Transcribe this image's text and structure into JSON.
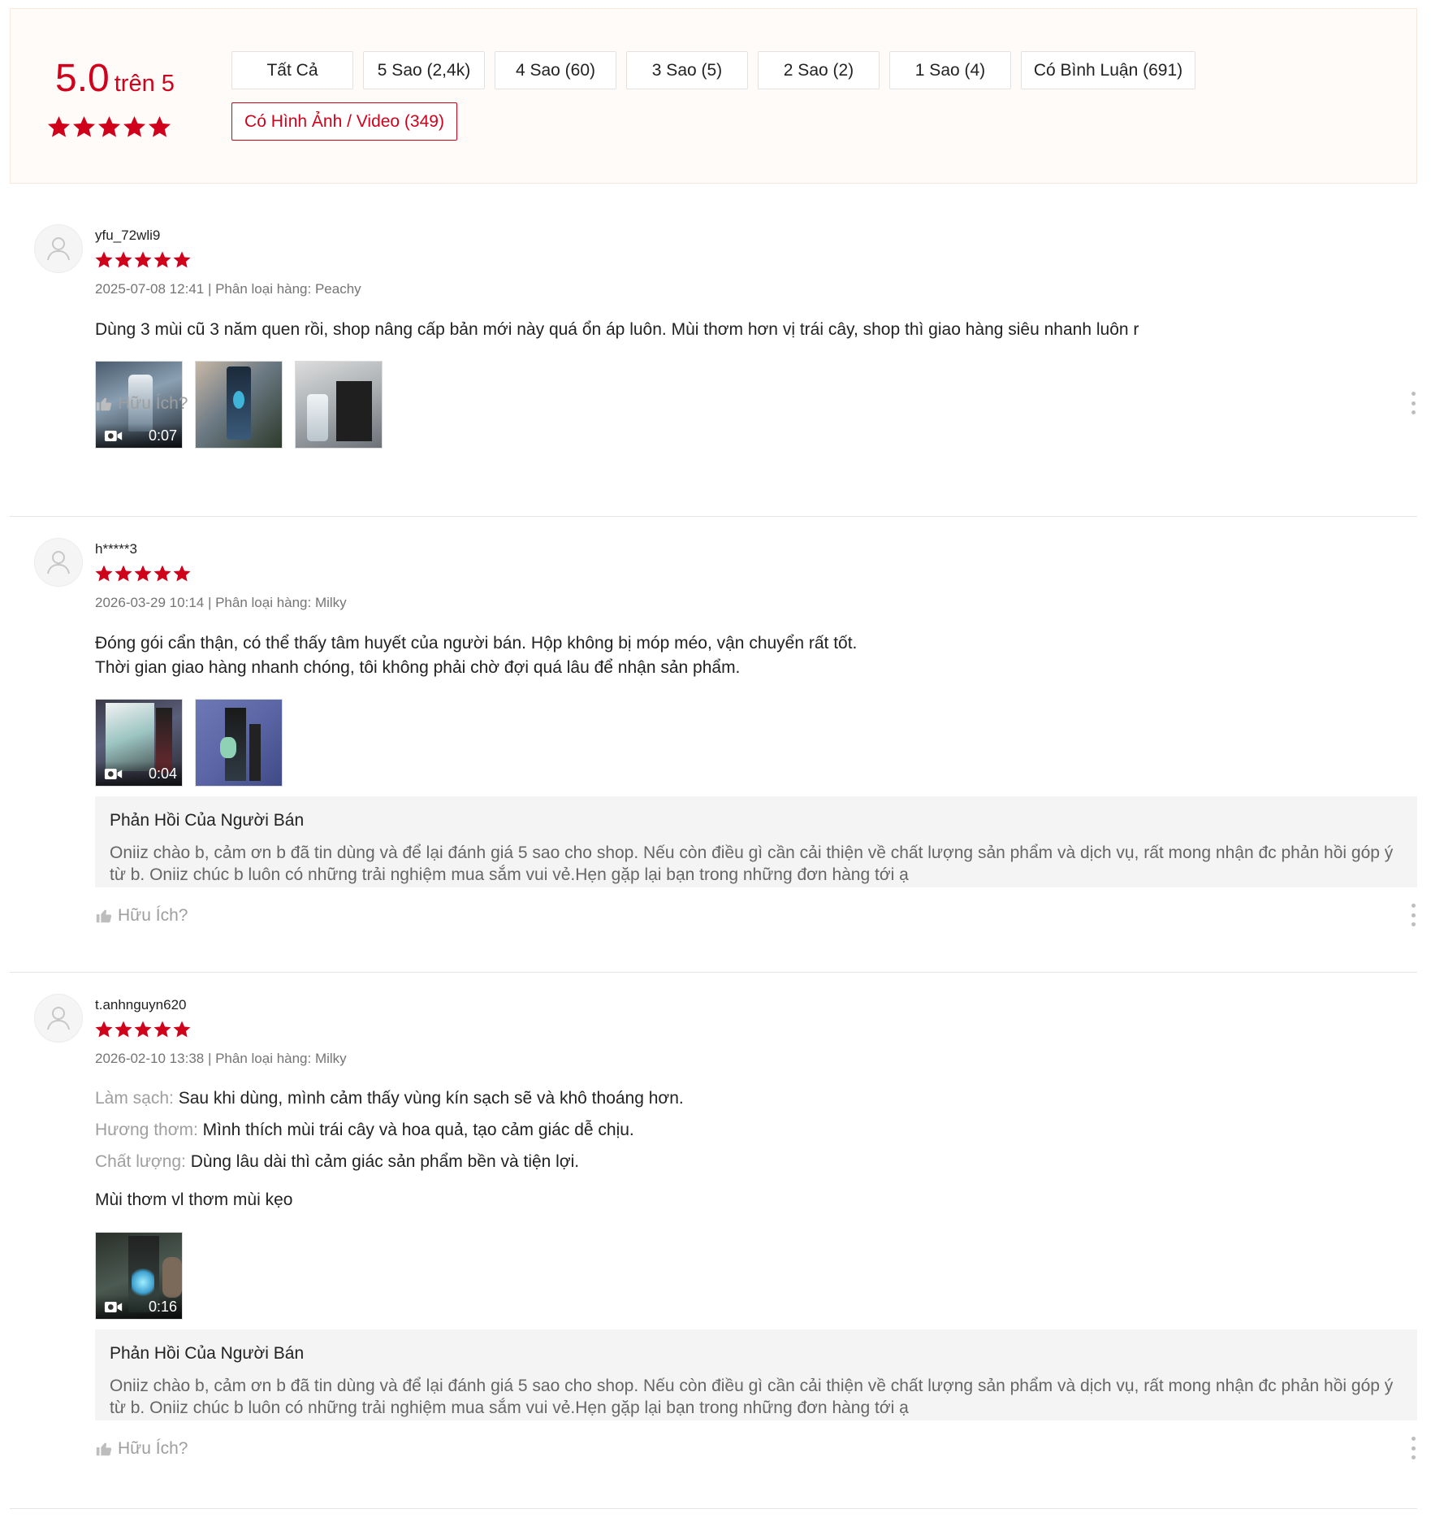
{
  "summary": {
    "score": "5.0",
    "out_of": "trên 5",
    "stars": 5,
    "filters": [
      "Tất Cả",
      "5 Sao (2,4k)",
      "4 Sao (60)",
      "3 Sao (5)",
      "2 Sao (2)",
      "1 Sao (4)",
      "Có Bình Luận (691)",
      "Có Hình Ảnh / Video (349)"
    ],
    "active_filter": "Có Hình Ảnh / Video (349)"
  },
  "colors": {
    "accent": "#d0011b",
    "summary_bg": "#fffbf8",
    "reply_bg": "#f4f4f4"
  },
  "reviews": [
    {
      "username": "yfu_72wli9",
      "rating": 5,
      "meta": "2025-07-08 12:41 | Phân loại hàng: Peachy",
      "content": [
        "Dùng 3 mùi cũ 3 năm quen rồi, shop nâng cấp bản mới này quá ổn áp luôn. Mùi thơm hơn vị trái cây, shop thì giao hàng siêu nhanh luôn r"
      ],
      "video_duration": "0:07",
      "helpful": "Hữu Ích?"
    },
    {
      "username": "h*****3",
      "rating": 5,
      "meta": "2026-03-29 10:14 | Phân loại hàng: Milky",
      "content": [
        "Đóng gói cẩn thận, có thể thấy tâm huyết của người bán. Hộp không bị móp méo, vận chuyển rất tốt.",
        "Thời gian giao hàng nhanh chóng, tôi không phải chờ đợi quá lâu để nhận sản phẩm."
      ],
      "video_duration": "0:04",
      "reply_title": "Phản Hồi Của Người Bán",
      "reply_body": "Oniiz chào b, cảm ơn b đã tin dùng và để lại đánh giá 5 sao cho shop. Nếu còn điều gì cần cải thiện về chất lượng sản phẩm và dịch vụ, rất mong nhận đc phản hồi góp ý từ b. Oniiz chúc b luôn có những trải nghiệm mua sắm vui vẻ.Hẹn gặp lại bạn trong những đơn hàng tới ạ",
      "helpful": "Hữu Ích?"
    },
    {
      "username": "t.anhnguyn620",
      "rating": 5,
      "meta": "2026-02-10 13:38 | Phân loại hàng: Milky",
      "attributes": [
        {
          "k": "Làm sạch:",
          "v": "Sau khi dùng, mình cảm thấy vùng kín sạch sẽ và khô thoáng hơn."
        },
        {
          "k": "Hương thơm:",
          "v": "Mình thích mùi trái cây và hoa quả, tạo cảm giác dễ chịu."
        },
        {
          "k": "Chất lượng:",
          "v": "Dùng lâu dài thì cảm giác sản phẩm bền và tiện lợi."
        }
      ],
      "content": [
        "Mùi thơm vl thơm mùi kẹo"
      ],
      "video_duration": "0:16",
      "reply_title": "Phản Hồi Của Người Bán",
      "reply_body": "Oniiz chào b, cảm ơn b đã tin dùng và để lại đánh giá 5 sao cho shop. Nếu còn điều gì cần cải thiện về chất lượng sản phẩm và dịch vụ, rất mong nhận đc phản hồi góp ý từ b. Oniiz chúc b luôn có những trải nghiệm mua sắm vui vẻ.Hẹn gặp lại bạn trong những đơn hàng tới ạ",
      "helpful": "Hữu Ích?"
    }
  ]
}
